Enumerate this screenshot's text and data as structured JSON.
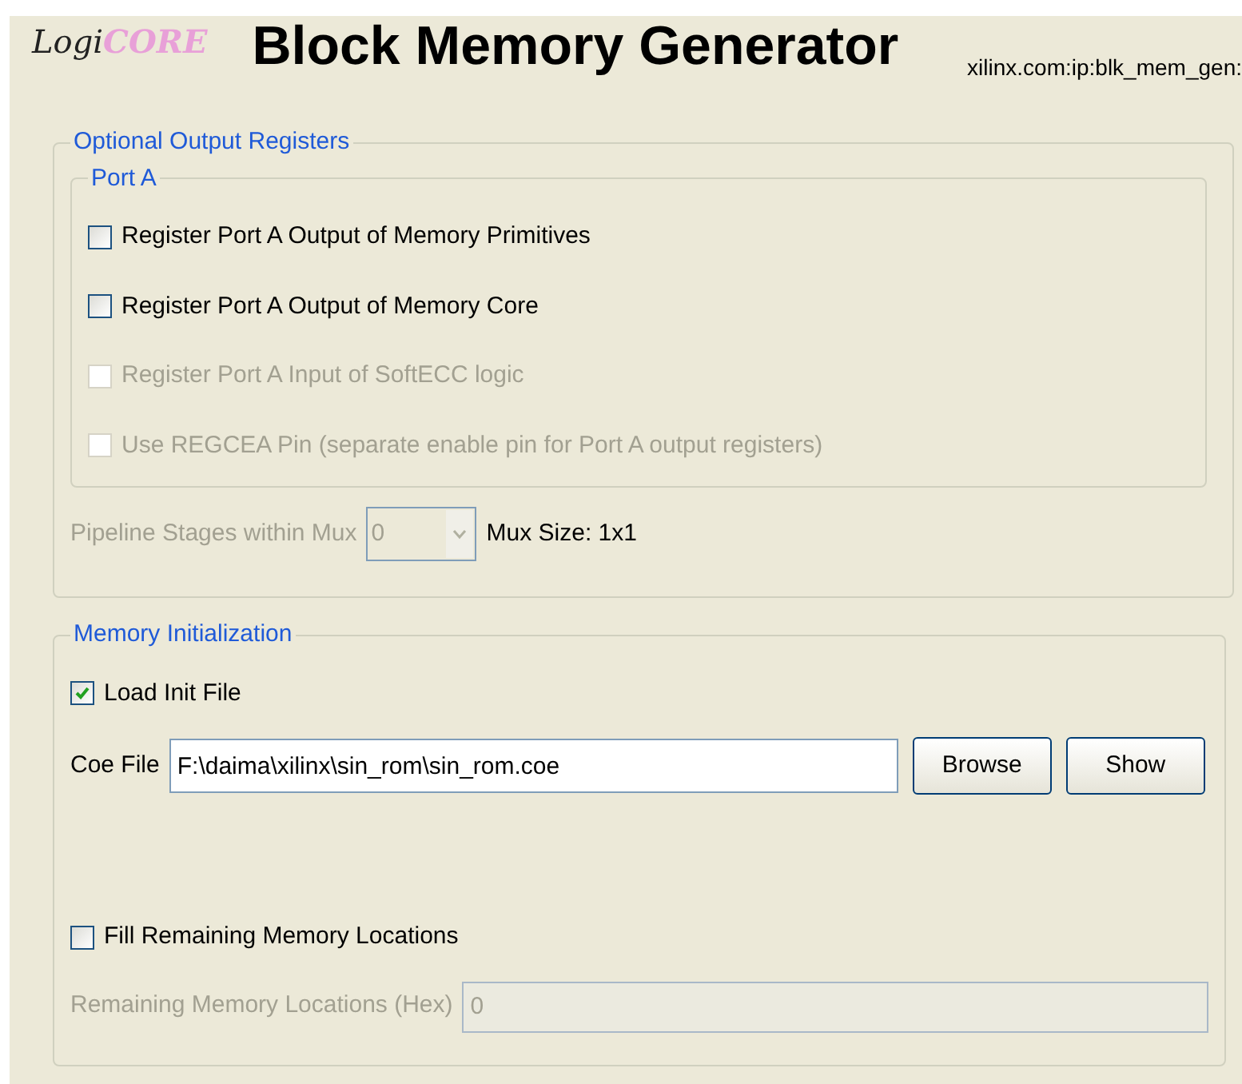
{
  "header": {
    "logo": {
      "part_1": "Logi",
      "part_2": "CORE"
    },
    "title": "Block Memory Generator",
    "version": "xilinx.com:ip:blk_mem_gen:"
  },
  "output_registers": {
    "legend": "Optional Output Registers",
    "port_a": {
      "legend": "Port A",
      "options": [
        {
          "label": "Register Port A Output of Memory Primitives",
          "checked": false,
          "disabled": false
        },
        {
          "label": "Register Port A Output of Memory Core",
          "checked": false,
          "disabled": false
        },
        {
          "label": "Register Port A Input of SoftECC logic",
          "checked": false,
          "disabled": true
        },
        {
          "label": "Use REGCEA Pin (separate enable pin for Port A output registers)",
          "checked": false,
          "disabled": true
        }
      ]
    },
    "pipeline": {
      "label": "Pipeline Stages within Mux",
      "value": "0",
      "disabled": true,
      "mux_size": "Mux Size: 1x1"
    }
  },
  "memory_init": {
    "legend": "Memory Initialization",
    "load_init": {
      "label": "Load Init File",
      "checked": true,
      "disabled": false
    },
    "coe_file": {
      "label": "Coe File",
      "value": "F:\\daima\\xilinx\\sin_rom\\sin_rom.coe"
    },
    "buttons": [
      "Browse",
      "Show"
    ],
    "fill_remaining": {
      "label": "Fill Remaining Memory Locations",
      "checked": false,
      "disabled": false
    },
    "remaining": {
      "label": "Remaining Memory Locations (Hex)",
      "value": "0",
      "disabled": true
    }
  }
}
